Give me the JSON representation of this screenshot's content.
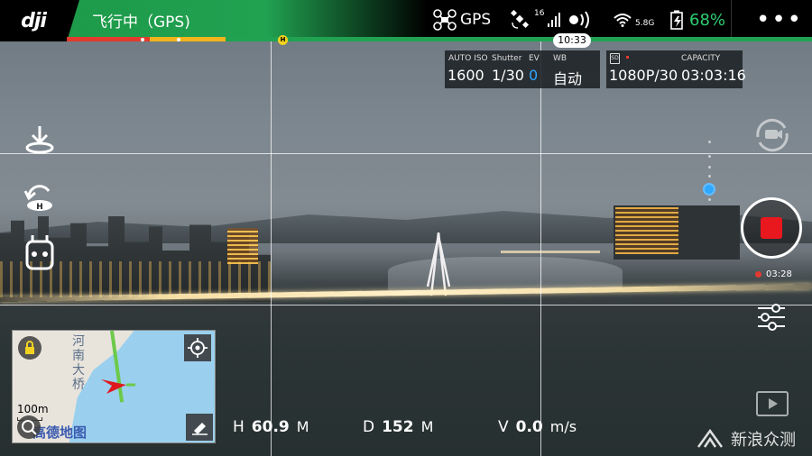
{
  "header": {
    "flight_status": "飞行中（GPS)",
    "gps_label": "GPS",
    "satellite_count": "16",
    "wifi_band": "5.8G",
    "battery_percent": "68%",
    "menu_label": "•••",
    "time": "10:33",
    "home_marker": "H"
  },
  "camera": {
    "iso_label": "AUTO ISO",
    "iso_value": "1600",
    "shutter_label": "Shutter",
    "shutter_value": "1/30",
    "ev_label": "EV",
    "ev_value": "0",
    "wb_label": "WB",
    "wb_value": "自动",
    "sd_label": "SD",
    "capacity_label": "CAPACITY",
    "resolution": "1080P/30",
    "capacity_value": "03:03:16"
  },
  "recording": {
    "time": "03:28"
  },
  "map": {
    "place_label": "河南大桥",
    "scale": "100m",
    "brand": "高德地图"
  },
  "telemetry": {
    "h_label": "H",
    "h_value": "60.9",
    "h_unit": "M",
    "d_label": "D",
    "d_value": "152",
    "d_unit": "M",
    "v_label": "V",
    "v_value": "0.0",
    "v_unit": "m/s"
  },
  "watermark": {
    "text": "新浪众测"
  },
  "brand": {
    "logo": "dji"
  },
  "colors": {
    "accent_green": "#21a251",
    "battery_green": "#2ecc71",
    "record_red": "#e8181e",
    "ev_blue": "#2fa8ff"
  }
}
